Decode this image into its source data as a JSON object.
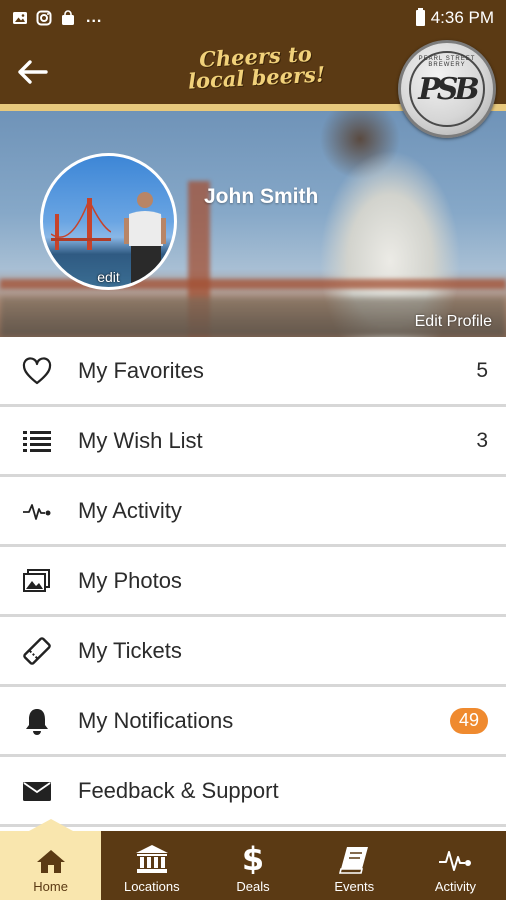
{
  "status_bar": {
    "time": "4:36 PM",
    "more": "..."
  },
  "header": {
    "tagline_line1": "Cheers to",
    "tagline_line2": "local beers!",
    "logo_monogram": "PSB",
    "logo_ring_text": "PEARL STREET BREWERY"
  },
  "profile": {
    "name": "John Smith",
    "avatar_edit": "edit",
    "edit_profile": "Edit Profile"
  },
  "menu": [
    {
      "label": "My Favorites",
      "count": "5"
    },
    {
      "label": "My Wish List",
      "count": "3"
    },
    {
      "label": "My Activity"
    },
    {
      "label": "My Photos"
    },
    {
      "label": "My Tickets"
    },
    {
      "label": "My Notifications",
      "badge": "49"
    },
    {
      "label": "Feedback & Support"
    }
  ],
  "nav": [
    {
      "label": "Home",
      "icon": "home-icon",
      "active": true
    },
    {
      "label": "Locations",
      "icon": "bank-icon"
    },
    {
      "label": "Deals",
      "icon": "dollar-icon"
    },
    {
      "label": "Events",
      "icon": "book-icon"
    },
    {
      "label": "Activity",
      "icon": "pulse-icon"
    }
  ],
  "colors": {
    "brown": "#5b3a14",
    "gold": "#e8c97d",
    "active_tab": "#f9e6ae",
    "badge": "#ef8a2f"
  }
}
